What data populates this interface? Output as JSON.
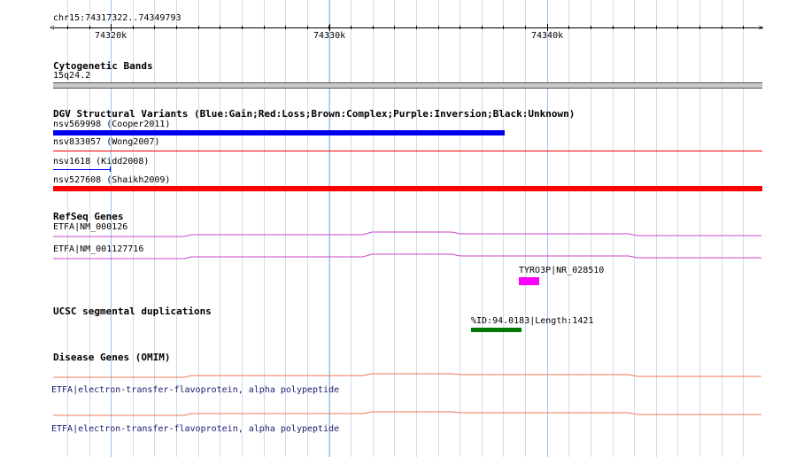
{
  "colors": {
    "gain": "#0000ee",
    "loss": "#ff0000",
    "refseq_line": "#cc44cc",
    "refseq_box": "#ff00ff",
    "segdup": "#007700",
    "omim_line": "#ee7755",
    "grid_major": "#9cc3e6",
    "grid_minor": "#c8ddf2",
    "cytoband": "#c8c8c8"
  },
  "ruler": {
    "location": "chr15:74317322..74349793",
    "ticks": [
      "74320k",
      "74330k",
      "74340k"
    ]
  },
  "tracks": {
    "cytoband": {
      "title": "Cytogenetic Bands",
      "band": "15q24.2"
    },
    "dgv": {
      "title": "DGV Structural Variants (Blue:Gain;Red:Loss;Brown:Complex;Purple:Inversion;Black:Unknown)",
      "items": [
        {
          "label": "nsv569998 (Cooper2011)",
          "type": "gain"
        },
        {
          "label": "nsv833057 (Wong2007)",
          "type": "loss"
        },
        {
          "label": "nsv1618 (Kidd2008)",
          "type": "gain"
        },
        {
          "label": "nsv527608 (Shaikh2009)",
          "type": "loss"
        }
      ]
    },
    "refseq": {
      "title": "RefSeq Genes",
      "items": [
        {
          "label": "ETFA|NM_000126"
        },
        {
          "label": "ETFA|NM_001127716"
        },
        {
          "label": "TYRO3P|NR_028510"
        }
      ]
    },
    "segdup": {
      "title": "UCSC segmental duplications",
      "items": [
        {
          "label": "%ID:94.0183|Length:1421"
        }
      ]
    },
    "omim": {
      "title": "Disease Genes (OMIM)",
      "items": [
        {
          "label": "ETFA|electron-transfer-flavoprotein, alpha polypeptide"
        },
        {
          "label": "ETFA|electron-transfer-flavoprotein, alpha polypeptide"
        }
      ]
    }
  }
}
